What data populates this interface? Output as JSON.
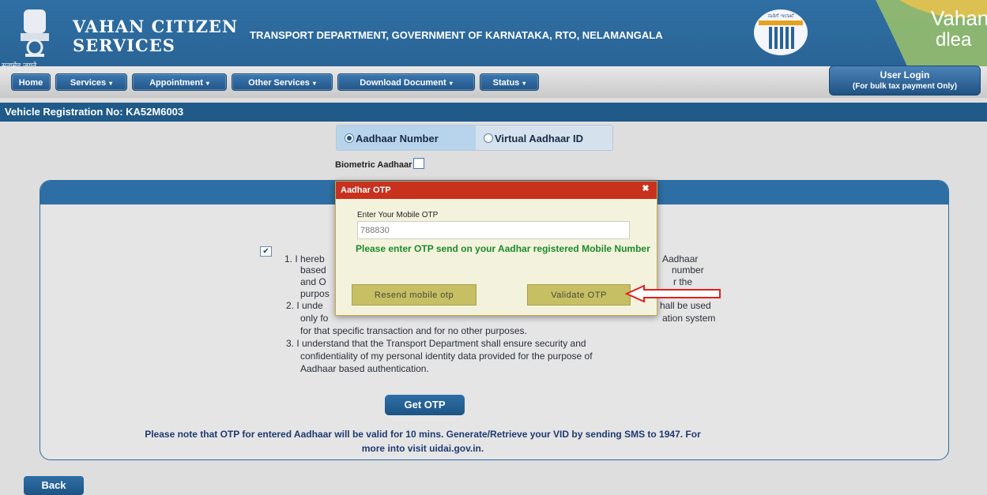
{
  "header": {
    "brand_line1": "VAHAN CITIZEN",
    "brand_line2": "SERVICES",
    "emblem_motto": "सत्यमेव जयते",
    "department_title": "TRANSPORT DEPARTMENT, GOVERNMENT OF KARNATAKA, RTO, NELAMANGALA",
    "seal_label": "ಸಾರಿಗೆ ಇಲಾಖೆ",
    "corner_logo": "Vahan",
    "corner_logo_sub": "dlea"
  },
  "nav": {
    "items": [
      {
        "label": "Home",
        "caret": ""
      },
      {
        "label": "Services",
        "caret": "▾"
      },
      {
        "label": "Appointment",
        "caret": "▾"
      },
      {
        "label": "Other Services",
        "caret": "▾"
      },
      {
        "label": "Download Document",
        "caret": "▾"
      },
      {
        "label": "Status",
        "caret": "▾"
      }
    ],
    "user_login": "User Login",
    "user_login_sub": "(For bulk tax payment Only)"
  },
  "vehicle": {
    "label": "Vehicle Registration No: KA52M6003"
  },
  "auth_type": {
    "options": [
      "Aadhaar Number",
      "Virtual Aadhaar ID"
    ],
    "selected": "Aadhaar Number",
    "biometric_label": "Biometric Aadhaar"
  },
  "consent": {
    "checked": true,
    "line_fragments": {
      "l1_left": "1. I hereb",
      "l1_right": "Aadhaar",
      "l2_left": "based",
      "l2_right": "number",
      "l3_left": "and O",
      "l3_right": "r the",
      "l4_left": "purpos",
      "l5_left": "2. I unde",
      "l5_right": "hall be used",
      "l6_left": "only fo",
      "l6_right": "ation system"
    },
    "lines_full": [
      "for that specific transaction and for no other purposes.",
      "3. I understand that the Transport Department shall ensure security and",
      "confidentiality of my personal identity data provided for the purpose of",
      "Aadhaar based authentication."
    ],
    "get_otp": "Get OTP",
    "note_line1": "Please note that OTP for entered Aadhaar will be valid for 10 mins. Generate/Retrieve your VID by sending SMS to 1947. For",
    "note_line2": "more into visit uidai.gov.in."
  },
  "modal": {
    "title": "Aadhar OTP",
    "close_glyph": "✖",
    "field_label": "Enter Your Mobile OTP",
    "otp_value": "788830",
    "message": "Please enter OTP send on your Aadhar registered Mobile Number",
    "resend_label": "Resend mobile otp",
    "validate_label": "Validate OTP"
  },
  "footer": {
    "back": "Back"
  },
  "colors": {
    "header_blue": "#2a6496",
    "modal_title_red": "#c8311d",
    "modal_button": "#c6bf63",
    "success_green": "#1c8b2c",
    "arrow_red": "#e02020"
  }
}
